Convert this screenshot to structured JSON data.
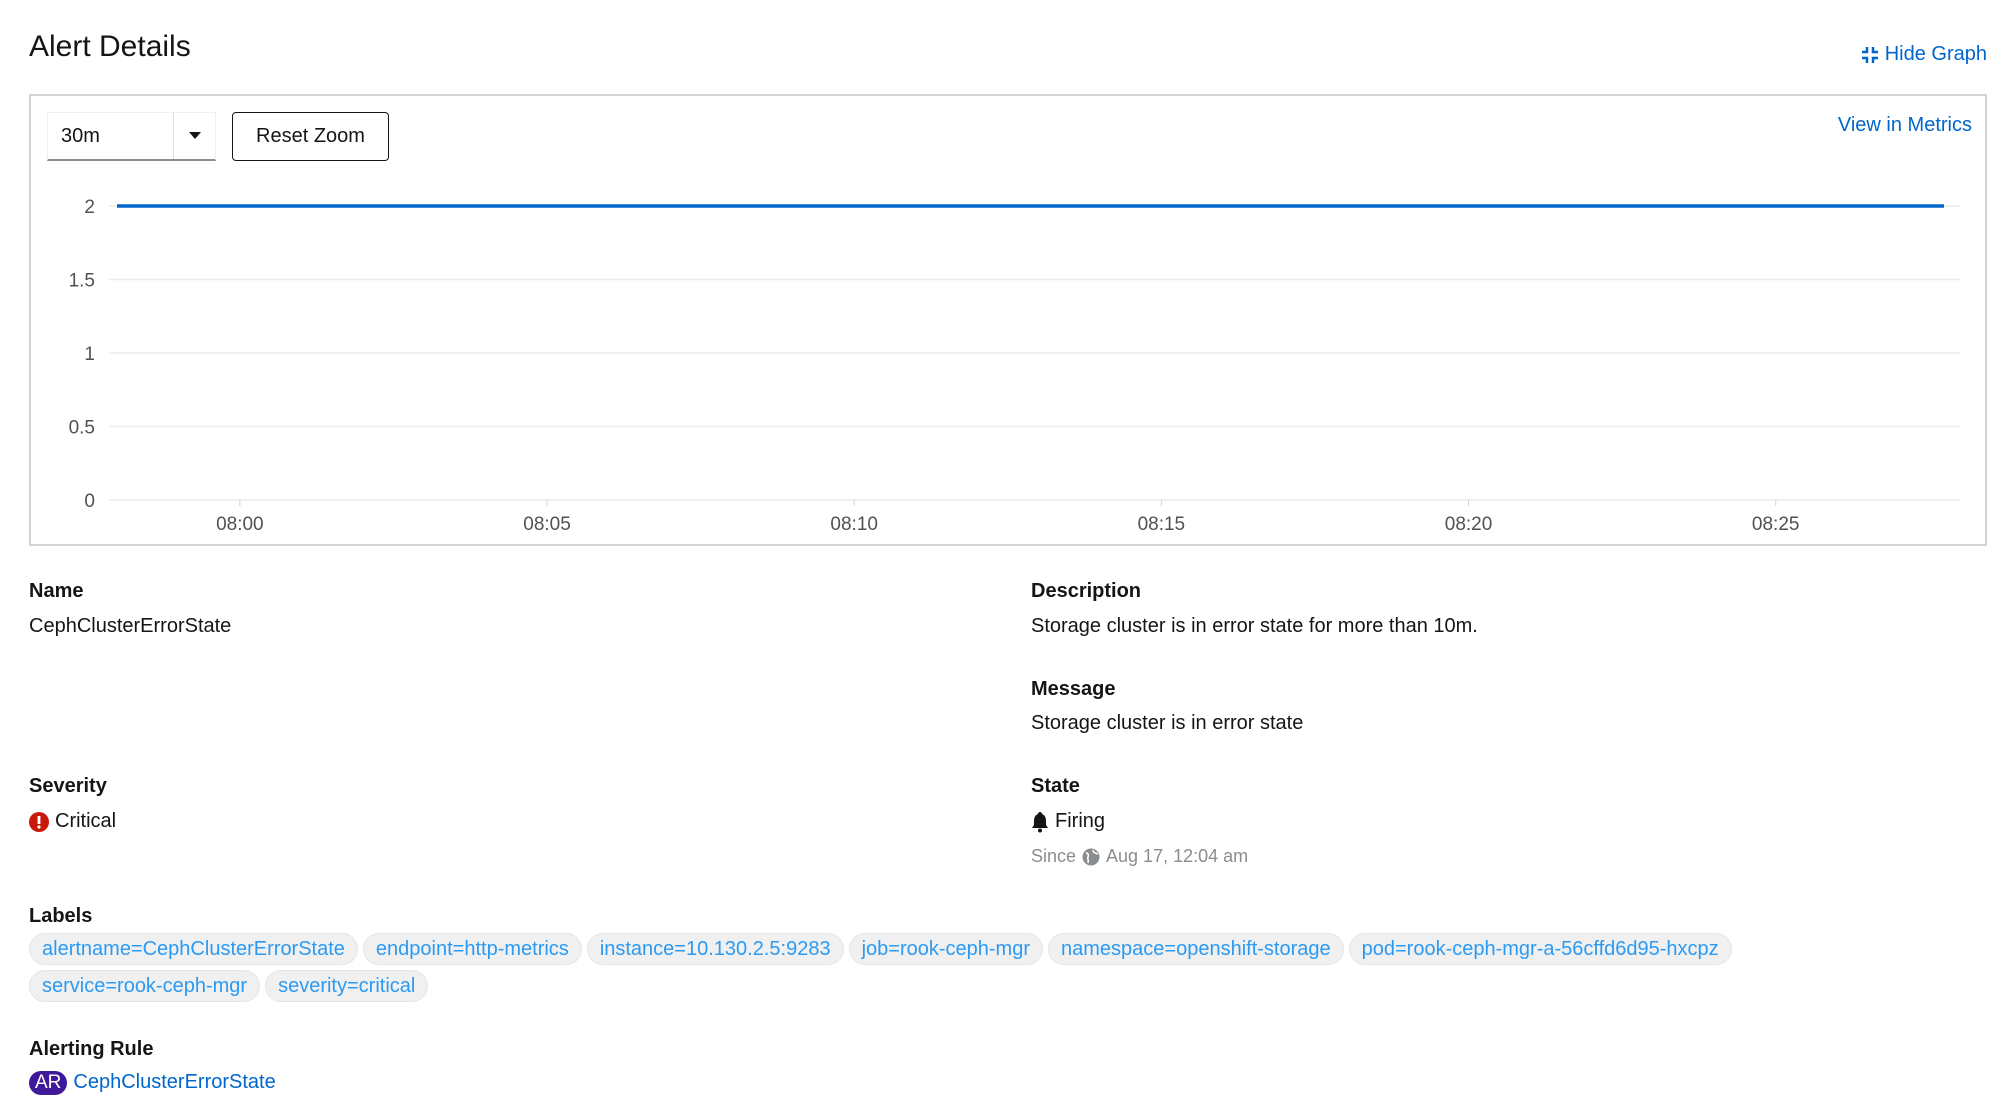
{
  "header": {
    "title": "Alert Details",
    "hide_graph": "Hide Graph"
  },
  "graph": {
    "timespan": "30m",
    "reset_zoom": "Reset Zoom",
    "view_in_metrics": "View in Metrics"
  },
  "chart_data": {
    "type": "line",
    "x": [
      "07:58",
      "08:28"
    ],
    "series": [
      {
        "values": [
          2,
          2
        ],
        "color": "#0066cc"
      }
    ],
    "yticks": [
      "0",
      "0.5",
      "1",
      "1.5",
      "2"
    ],
    "xticks": [
      "08:00",
      "08:05",
      "08:10",
      "08:15",
      "08:20",
      "08:25"
    ],
    "ylim": [
      0,
      2
    ],
    "grid": true
  },
  "details": {
    "name_label": "Name",
    "name": "CephClusterErrorState",
    "description_label": "Description",
    "description": "Storage cluster is in error state for more than 10m.",
    "message_label": "Message",
    "message": "Storage cluster is in error state",
    "severity_label": "Severity",
    "severity": "Critical",
    "severity_color": "#c9190b",
    "state_label": "State",
    "state": "Firing",
    "since_prefix": "Since",
    "since": "Aug 17, 12:04 am",
    "labels_label": "Labels",
    "labels": [
      "alertname=CephClusterErrorState",
      "endpoint=http-metrics",
      "instance=10.130.2.5:9283",
      "job=rook-ceph-mgr",
      "namespace=openshift-storage",
      "pod=rook-ceph-mgr-a-56cffd6d95-hxcpz",
      "service=rook-ceph-mgr",
      "severity=critical"
    ],
    "rule_label": "Alerting Rule",
    "rule_badge": "AR",
    "rule": "CephClusterErrorState"
  }
}
